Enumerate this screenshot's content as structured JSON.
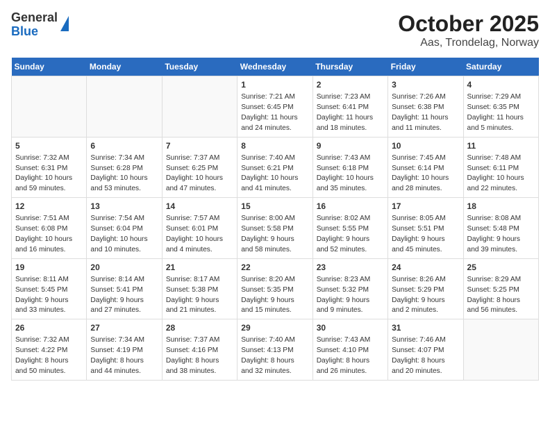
{
  "header": {
    "logo": {
      "general": "General",
      "blue": "Blue"
    },
    "title": "October 2025",
    "subtitle": "Aas, Trondelag, Norway"
  },
  "weekdays": [
    "Sunday",
    "Monday",
    "Tuesday",
    "Wednesday",
    "Thursday",
    "Friday",
    "Saturday"
  ],
  "weeks": [
    [
      {
        "day": "",
        "content": ""
      },
      {
        "day": "",
        "content": ""
      },
      {
        "day": "",
        "content": ""
      },
      {
        "day": "1",
        "content": "Sunrise: 7:21 AM\nSunset: 6:45 PM\nDaylight: 11 hours\nand 24 minutes."
      },
      {
        "day": "2",
        "content": "Sunrise: 7:23 AM\nSunset: 6:41 PM\nDaylight: 11 hours\nand 18 minutes."
      },
      {
        "day": "3",
        "content": "Sunrise: 7:26 AM\nSunset: 6:38 PM\nDaylight: 11 hours\nand 11 minutes."
      },
      {
        "day": "4",
        "content": "Sunrise: 7:29 AM\nSunset: 6:35 PM\nDaylight: 11 hours\nand 5 minutes."
      }
    ],
    [
      {
        "day": "5",
        "content": "Sunrise: 7:32 AM\nSunset: 6:31 PM\nDaylight: 10 hours\nand 59 minutes."
      },
      {
        "day": "6",
        "content": "Sunrise: 7:34 AM\nSunset: 6:28 PM\nDaylight: 10 hours\nand 53 minutes."
      },
      {
        "day": "7",
        "content": "Sunrise: 7:37 AM\nSunset: 6:25 PM\nDaylight: 10 hours\nand 47 minutes."
      },
      {
        "day": "8",
        "content": "Sunrise: 7:40 AM\nSunset: 6:21 PM\nDaylight: 10 hours\nand 41 minutes."
      },
      {
        "day": "9",
        "content": "Sunrise: 7:43 AM\nSunset: 6:18 PM\nDaylight: 10 hours\nand 35 minutes."
      },
      {
        "day": "10",
        "content": "Sunrise: 7:45 AM\nSunset: 6:14 PM\nDaylight: 10 hours\nand 28 minutes."
      },
      {
        "day": "11",
        "content": "Sunrise: 7:48 AM\nSunset: 6:11 PM\nDaylight: 10 hours\nand 22 minutes."
      }
    ],
    [
      {
        "day": "12",
        "content": "Sunrise: 7:51 AM\nSunset: 6:08 PM\nDaylight: 10 hours\nand 16 minutes."
      },
      {
        "day": "13",
        "content": "Sunrise: 7:54 AM\nSunset: 6:04 PM\nDaylight: 10 hours\nand 10 minutes."
      },
      {
        "day": "14",
        "content": "Sunrise: 7:57 AM\nSunset: 6:01 PM\nDaylight: 10 hours\nand 4 minutes."
      },
      {
        "day": "15",
        "content": "Sunrise: 8:00 AM\nSunset: 5:58 PM\nDaylight: 9 hours\nand 58 minutes."
      },
      {
        "day": "16",
        "content": "Sunrise: 8:02 AM\nSunset: 5:55 PM\nDaylight: 9 hours\nand 52 minutes."
      },
      {
        "day": "17",
        "content": "Sunrise: 8:05 AM\nSunset: 5:51 PM\nDaylight: 9 hours\nand 45 minutes."
      },
      {
        "day": "18",
        "content": "Sunrise: 8:08 AM\nSunset: 5:48 PM\nDaylight: 9 hours\nand 39 minutes."
      }
    ],
    [
      {
        "day": "19",
        "content": "Sunrise: 8:11 AM\nSunset: 5:45 PM\nDaylight: 9 hours\nand 33 minutes."
      },
      {
        "day": "20",
        "content": "Sunrise: 8:14 AM\nSunset: 5:41 PM\nDaylight: 9 hours\nand 27 minutes."
      },
      {
        "day": "21",
        "content": "Sunrise: 8:17 AM\nSunset: 5:38 PM\nDaylight: 9 hours\nand 21 minutes."
      },
      {
        "day": "22",
        "content": "Sunrise: 8:20 AM\nSunset: 5:35 PM\nDaylight: 9 hours\nand 15 minutes."
      },
      {
        "day": "23",
        "content": "Sunrise: 8:23 AM\nSunset: 5:32 PM\nDaylight: 9 hours\nand 9 minutes."
      },
      {
        "day": "24",
        "content": "Sunrise: 8:26 AM\nSunset: 5:29 PM\nDaylight: 9 hours\nand 2 minutes."
      },
      {
        "day": "25",
        "content": "Sunrise: 8:29 AM\nSunset: 5:25 PM\nDaylight: 8 hours\nand 56 minutes."
      }
    ],
    [
      {
        "day": "26",
        "content": "Sunrise: 7:32 AM\nSunset: 4:22 PM\nDaylight: 8 hours\nand 50 minutes."
      },
      {
        "day": "27",
        "content": "Sunrise: 7:34 AM\nSunset: 4:19 PM\nDaylight: 8 hours\nand 44 minutes."
      },
      {
        "day": "28",
        "content": "Sunrise: 7:37 AM\nSunset: 4:16 PM\nDaylight: 8 hours\nand 38 minutes."
      },
      {
        "day": "29",
        "content": "Sunrise: 7:40 AM\nSunset: 4:13 PM\nDaylight: 8 hours\nand 32 minutes."
      },
      {
        "day": "30",
        "content": "Sunrise: 7:43 AM\nSunset: 4:10 PM\nDaylight: 8 hours\nand 26 minutes."
      },
      {
        "day": "31",
        "content": "Sunrise: 7:46 AM\nSunset: 4:07 PM\nDaylight: 8 hours\nand 20 minutes."
      },
      {
        "day": "",
        "content": ""
      }
    ]
  ]
}
